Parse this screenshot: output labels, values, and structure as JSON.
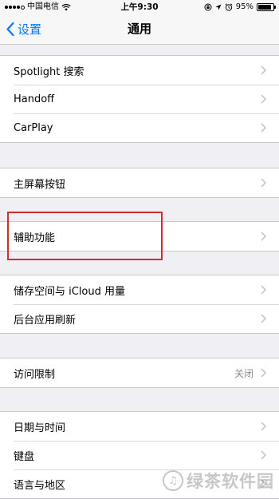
{
  "status_bar": {
    "carrier": "中国电信",
    "time": "上午9:30",
    "battery": "95%"
  },
  "nav": {
    "back_label": "设置",
    "title": "通用"
  },
  "groups": [
    {
      "rows": [
        {
          "label": "Spotlight 搜索"
        },
        {
          "label": "Handoff"
        },
        {
          "label": "CarPlay"
        }
      ]
    },
    {
      "rows": [
        {
          "label": "主屏幕按钮"
        }
      ]
    },
    {
      "rows": [
        {
          "label": "辅助功能"
        }
      ]
    },
    {
      "rows": [
        {
          "label": "储存空间与 iCloud 用量"
        },
        {
          "label": "后台应用刷新"
        }
      ]
    },
    {
      "rows": [
        {
          "label": "访问限制",
          "value": "关闭"
        }
      ]
    },
    {
      "rows": [
        {
          "label": "日期与时间"
        },
        {
          "label": "键盘"
        },
        {
          "label": "语言与地区"
        }
      ]
    }
  ],
  "watermark": {
    "text": "绿茶软件园"
  },
  "colors": {
    "accent": "#007aff",
    "highlight": "#d42b2b"
  }
}
